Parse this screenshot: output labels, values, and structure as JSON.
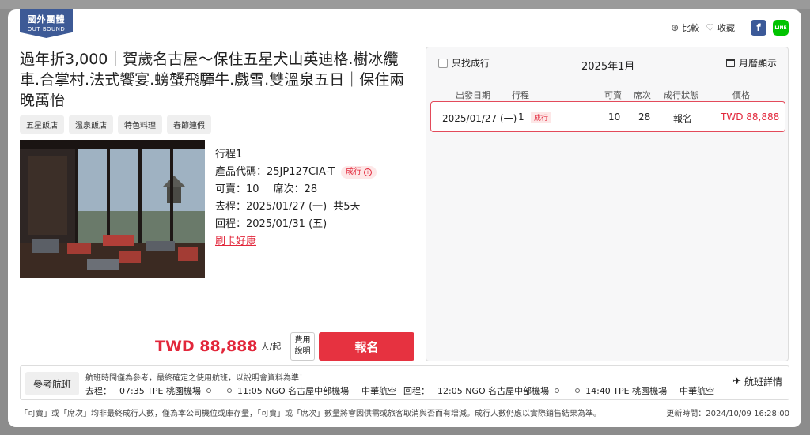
{
  "badge": {
    "line1": "國外團體",
    "line2": "OUT BOUND"
  },
  "top_actions": {
    "compare": "比較",
    "favorite": "收藏",
    "line_label": "LINE"
  },
  "title": "過年折3,000｜賀歲名古屋～保住五星犬山英迪格.樹冰纜車.合掌村.法式饗宴.螃蟹飛驒牛.戲雪.雙溫泉五日｜保住兩晚萬怡",
  "tags": [
    "五星飯店",
    "溫泉飯店",
    "特色料理",
    "春節連假"
  ],
  "info": {
    "itinerary": "行程1",
    "code_label": "產品代碼：",
    "code": "25JP127CIA-T",
    "status": "成行",
    "available_label": "可賣：",
    "available": "10",
    "seats_label": "席次：",
    "seats": "28",
    "depart_label": "去程：",
    "depart": "2025/01/27 (一)",
    "duration": "共5天",
    "return_label": "回程：",
    "return": "2025/01/31 (五)",
    "promo": "刷卡好康"
  },
  "price": {
    "amount": "TWD 88,888",
    "per": "人/起",
    "fee_btn": "費用\n說明",
    "signup": "報名"
  },
  "side": {
    "only_confirmed": "只找成行",
    "month": "2025年1月",
    "calendar_view": "月曆顯示",
    "headers": [
      "出發日期",
      "行程",
      "可賣",
      "席次",
      "成行狀態",
      "價格"
    ],
    "rows": [
      {
        "date": "2025/01/27 (一)",
        "itinerary": "1",
        "tag": "成行",
        "available": "10",
        "seats": "28",
        "status": "報名",
        "price": "TWD  88,888"
      }
    ]
  },
  "flight": {
    "ref_btn": "參考航班",
    "note": "航班時間僅為參考，最終確定之使用航班，以說明會資料為準！",
    "outbound_label": "去程：",
    "outbound_dep": "07:35 TPE 桃園機場",
    "outbound_arr": "11:05 NGO 名古屋中部機場",
    "outbound_airline": "中華航空",
    "return_label": "回程：",
    "return_dep": "12:05 NGO 名古屋中部機場",
    "return_arr": "14:40 TPE 桃園機場",
    "return_airline": "中華航空",
    "detail_btn": "航班詳情"
  },
  "footer": {
    "note": "「可賣」或「席次」均非最終成行人數，僅為本公司機位或庫存量，「可賣」或「席次」數量將會因供需或旅客取消與否而有增減。成行人數仍應以實際銷售結果為準。",
    "update": "更新時間：2024/10/09 16:28:00"
  },
  "colors": {
    "accent": "#e2273b",
    "badge": "#3d5a96",
    "facebook": "#3b5998",
    "line": "#00c300"
  }
}
